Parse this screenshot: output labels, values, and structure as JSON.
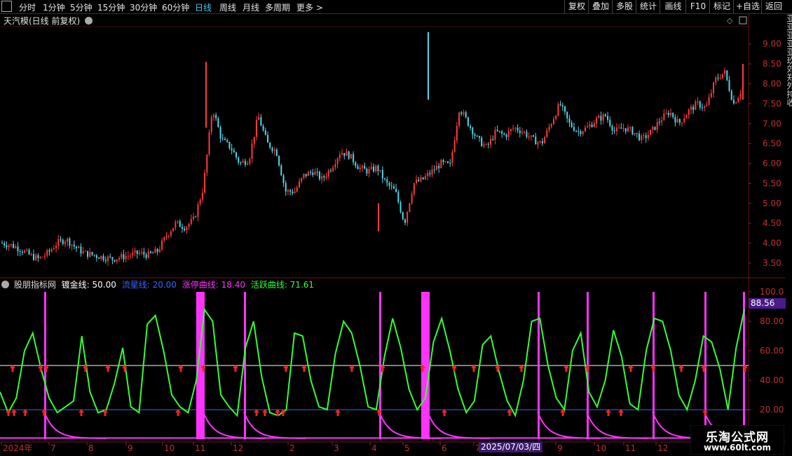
{
  "toolbar": {
    "periods": [
      "分时",
      "1分钟",
      "5分钟",
      "15分钟",
      "30分钟",
      "60分钟",
      "日线",
      "周线",
      "月线",
      "多周期",
      "更多 >"
    ],
    "active_period": "日线",
    "right_buttons": [
      "复权",
      "叠加",
      "多股",
      "统计",
      "画线",
      "F10",
      "标记",
      "+自选",
      "返回"
    ]
  },
  "main_panel": {
    "title": "天汽模(日线 前复权)",
    "y_ticks": [
      "9.00",
      "8.50",
      "8.00",
      "7.50",
      "7.00",
      "6.50",
      "6.00",
      "5.50",
      "5.00",
      "4.50",
      "4.00",
      "3.50"
    ]
  },
  "sub_panel": {
    "title": "股朋指标网",
    "legend": [
      {
        "label": "镀金线: 50.00",
        "color": "#ffffff"
      },
      {
        "label": "流星线: 20.00",
        "color": "#3366ff"
      },
      {
        "label": "涨停曲线: 18.40",
        "color": "#ff33ff"
      },
      {
        "label": "活跃曲线: 71.61",
        "color": "#33ff33"
      }
    ],
    "y_ticks": [
      "100.0",
      "80.00",
      "60.00",
      "40.00",
      "20.00"
    ],
    "current_value": "88.56"
  },
  "x_axis": {
    "labels": [
      "2024年",
      "7",
      "8",
      "9",
      "10",
      "11",
      "12",
      "2",
      "3",
      "4",
      "5",
      "6",
      "7",
      "8",
      "9",
      "10",
      "11",
      "12",
      "2"
    ],
    "cursor_date": "2025/07/03/四"
  },
  "watermark": {
    "line1": "乐淘公式网",
    "line2": "www.60lt.com"
  },
  "right_strip_text": "亚亚亚亚亚玖郊郑外持收",
  "colors": {
    "up": "#ff3b3b",
    "down": "#4fd8ec",
    "active": "#33ff33",
    "limit": "#ff33ff",
    "gold": "#ffffff",
    "meteor": "#3366ff",
    "arrow": "#ff2020"
  },
  "chart_data": [
    {
      "type": "candlestick",
      "title": "天汽模(日线 前复权)",
      "ylim": [
        3.2,
        9.4
      ],
      "close_trend": [
        4.0,
        3.95,
        3.85,
        3.7,
        3.6,
        3.75,
        4.0,
        4.1,
        3.9,
        3.75,
        3.7,
        3.65,
        3.6,
        3.65,
        3.7,
        3.75,
        3.7,
        3.8,
        4.2,
        4.5,
        4.4,
        4.6,
        5.4,
        7.4,
        6.6,
        6.4,
        6.0,
        6.1,
        7.2,
        6.5,
        6.3,
        5.3,
        5.3,
        5.7,
        5.8,
        5.6,
        5.9,
        6.3,
        6.2,
        5.9,
        5.8,
        5.9,
        5.5,
        5.3,
        4.5,
        5.5,
        5.6,
        5.8,
        6.0,
        5.95,
        7.4,
        7.0,
        6.6,
        6.4,
        6.8,
        6.7,
        6.9,
        6.8,
        6.6,
        6.5,
        7.0,
        7.5,
        7.0,
        6.8,
        6.9,
        7.1,
        7.2,
        6.8,
        6.9,
        6.8,
        6.6,
        6.8,
        7.1,
        7.3,
        7.0,
        7.3,
        7.5,
        7.4,
        8.1,
        8.3,
        7.5,
        7.9
      ]
    },
    {
      "type": "line",
      "title": "股朋指标网",
      "ylim": [
        0,
        100
      ],
      "series": [
        {
          "name": "镀金线",
          "values": [
            50,
            50
          ]
        },
        {
          "name": "流星线",
          "values": [
            20,
            20
          ]
        },
        {
          "name": "活跃曲线",
          "values": [
            32,
            18,
            28,
            60,
            72,
            48,
            28,
            18,
            22,
            26,
            70,
            32,
            18,
            20,
            38,
            62,
            22,
            18,
            78,
            84,
            60,
            30,
            22,
            18,
            40,
            88,
            80,
            30,
            22,
            16,
            62,
            80,
            42,
            18,
            16,
            20,
            72,
            70,
            40,
            22,
            20,
            58,
            80,
            72,
            50,
            22,
            20,
            56,
            82,
            62,
            34,
            20,
            28,
            66,
            82,
            60,
            34,
            18,
            26,
            64,
            70,
            46,
            26,
            16,
            40,
            80,
            82,
            50,
            28,
            20,
            60,
            72,
            32,
            22,
            40,
            74,
            56,
            24,
            20,
            60,
            82,
            80,
            60,
            30,
            20,
            40,
            70,
            66,
            48,
            20,
            62,
            88
          ]
        },
        {
          "name": "涨停曲线",
          "values": [
            0,
            0,
            100,
            18,
            8,
            4,
            2,
            100,
            18,
            6,
            3,
            2,
            100,
            16,
            6,
            3,
            2,
            100,
            18,
            8,
            4,
            2,
            100,
            18,
            8,
            3,
            2,
            100,
            16,
            6,
            3,
            100,
            16,
            6,
            3,
            100,
            18,
            6,
            3,
            100,
            16,
            6,
            3,
            100,
            18,
            6,
            3,
            0
          ]
        }
      ]
    }
  ]
}
